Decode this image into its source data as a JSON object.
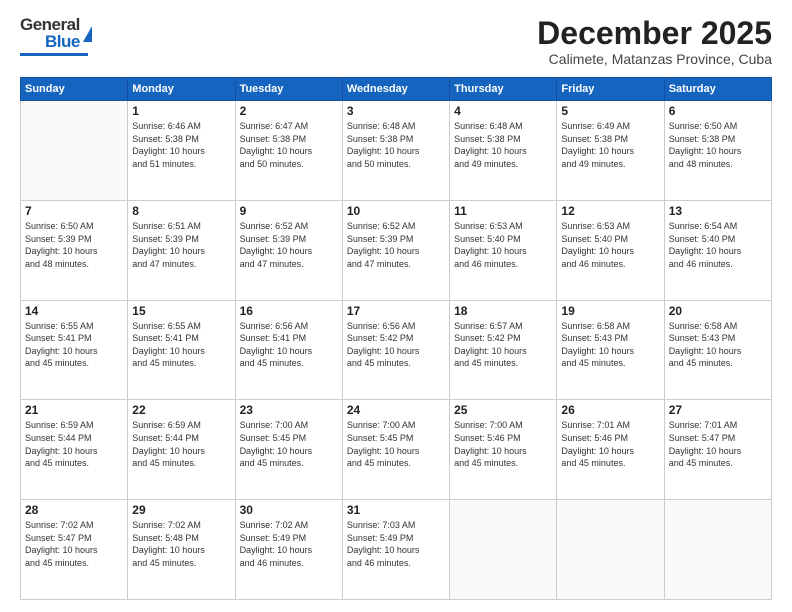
{
  "header": {
    "logo_general": "General",
    "logo_blue": "Blue",
    "month": "December 2025",
    "location": "Calimete, Matanzas Province, Cuba"
  },
  "weekdays": [
    "Sunday",
    "Monday",
    "Tuesday",
    "Wednesday",
    "Thursday",
    "Friday",
    "Saturday"
  ],
  "weeks": [
    [
      {
        "day": "",
        "info": ""
      },
      {
        "day": "1",
        "info": "Sunrise: 6:46 AM\nSunset: 5:38 PM\nDaylight: 10 hours\nand 51 minutes."
      },
      {
        "day": "2",
        "info": "Sunrise: 6:47 AM\nSunset: 5:38 PM\nDaylight: 10 hours\nand 50 minutes."
      },
      {
        "day": "3",
        "info": "Sunrise: 6:48 AM\nSunset: 5:38 PM\nDaylight: 10 hours\nand 50 minutes."
      },
      {
        "day": "4",
        "info": "Sunrise: 6:48 AM\nSunset: 5:38 PM\nDaylight: 10 hours\nand 49 minutes."
      },
      {
        "day": "5",
        "info": "Sunrise: 6:49 AM\nSunset: 5:38 PM\nDaylight: 10 hours\nand 49 minutes."
      },
      {
        "day": "6",
        "info": "Sunrise: 6:50 AM\nSunset: 5:38 PM\nDaylight: 10 hours\nand 48 minutes."
      }
    ],
    [
      {
        "day": "7",
        "info": "Sunrise: 6:50 AM\nSunset: 5:39 PM\nDaylight: 10 hours\nand 48 minutes."
      },
      {
        "day": "8",
        "info": "Sunrise: 6:51 AM\nSunset: 5:39 PM\nDaylight: 10 hours\nand 47 minutes."
      },
      {
        "day": "9",
        "info": "Sunrise: 6:52 AM\nSunset: 5:39 PM\nDaylight: 10 hours\nand 47 minutes."
      },
      {
        "day": "10",
        "info": "Sunrise: 6:52 AM\nSunset: 5:39 PM\nDaylight: 10 hours\nand 47 minutes."
      },
      {
        "day": "11",
        "info": "Sunrise: 6:53 AM\nSunset: 5:40 PM\nDaylight: 10 hours\nand 46 minutes."
      },
      {
        "day": "12",
        "info": "Sunrise: 6:53 AM\nSunset: 5:40 PM\nDaylight: 10 hours\nand 46 minutes."
      },
      {
        "day": "13",
        "info": "Sunrise: 6:54 AM\nSunset: 5:40 PM\nDaylight: 10 hours\nand 46 minutes."
      }
    ],
    [
      {
        "day": "14",
        "info": "Sunrise: 6:55 AM\nSunset: 5:41 PM\nDaylight: 10 hours\nand 45 minutes."
      },
      {
        "day": "15",
        "info": "Sunrise: 6:55 AM\nSunset: 5:41 PM\nDaylight: 10 hours\nand 45 minutes."
      },
      {
        "day": "16",
        "info": "Sunrise: 6:56 AM\nSunset: 5:41 PM\nDaylight: 10 hours\nand 45 minutes."
      },
      {
        "day": "17",
        "info": "Sunrise: 6:56 AM\nSunset: 5:42 PM\nDaylight: 10 hours\nand 45 minutes."
      },
      {
        "day": "18",
        "info": "Sunrise: 6:57 AM\nSunset: 5:42 PM\nDaylight: 10 hours\nand 45 minutes."
      },
      {
        "day": "19",
        "info": "Sunrise: 6:58 AM\nSunset: 5:43 PM\nDaylight: 10 hours\nand 45 minutes."
      },
      {
        "day": "20",
        "info": "Sunrise: 6:58 AM\nSunset: 5:43 PM\nDaylight: 10 hours\nand 45 minutes."
      }
    ],
    [
      {
        "day": "21",
        "info": "Sunrise: 6:59 AM\nSunset: 5:44 PM\nDaylight: 10 hours\nand 45 minutes."
      },
      {
        "day": "22",
        "info": "Sunrise: 6:59 AM\nSunset: 5:44 PM\nDaylight: 10 hours\nand 45 minutes."
      },
      {
        "day": "23",
        "info": "Sunrise: 7:00 AM\nSunset: 5:45 PM\nDaylight: 10 hours\nand 45 minutes."
      },
      {
        "day": "24",
        "info": "Sunrise: 7:00 AM\nSunset: 5:45 PM\nDaylight: 10 hours\nand 45 minutes."
      },
      {
        "day": "25",
        "info": "Sunrise: 7:00 AM\nSunset: 5:46 PM\nDaylight: 10 hours\nand 45 minutes."
      },
      {
        "day": "26",
        "info": "Sunrise: 7:01 AM\nSunset: 5:46 PM\nDaylight: 10 hours\nand 45 minutes."
      },
      {
        "day": "27",
        "info": "Sunrise: 7:01 AM\nSunset: 5:47 PM\nDaylight: 10 hours\nand 45 minutes."
      }
    ],
    [
      {
        "day": "28",
        "info": "Sunrise: 7:02 AM\nSunset: 5:47 PM\nDaylight: 10 hours\nand 45 minutes."
      },
      {
        "day": "29",
        "info": "Sunrise: 7:02 AM\nSunset: 5:48 PM\nDaylight: 10 hours\nand 45 minutes."
      },
      {
        "day": "30",
        "info": "Sunrise: 7:02 AM\nSunset: 5:49 PM\nDaylight: 10 hours\nand 46 minutes."
      },
      {
        "day": "31",
        "info": "Sunrise: 7:03 AM\nSunset: 5:49 PM\nDaylight: 10 hours\nand 46 minutes."
      },
      {
        "day": "",
        "info": ""
      },
      {
        "day": "",
        "info": ""
      },
      {
        "day": "",
        "info": ""
      }
    ]
  ]
}
